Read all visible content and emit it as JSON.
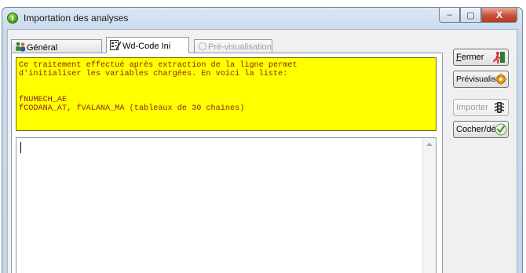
{
  "window": {
    "title": "Importation des analyses",
    "controls": {
      "minimize": "‒",
      "maximize": "▢",
      "close": "X"
    }
  },
  "tabs": [
    {
      "label": "Général",
      "icon": "people-icon",
      "state": "normal"
    },
    {
      "label": "Wd-Code Ini",
      "icon": "code-edit-icon",
      "state": "active"
    },
    {
      "label": "Pré-visualisation",
      "icon": "preview-icon",
      "state": "disabled"
    }
  ],
  "info_box": {
    "lines": [
      "Ce traitement effectué après extraction de la ligne permet",
      "d'initialiser les variables chargées. En voici la liste:",
      "",
      "",
      "fNUMECH_AE",
      "fCODANA_AT, fVALANA_MA (tableaux de 30 chaines)"
    ],
    "background": "#ffff00",
    "text_color": "#8b2323"
  },
  "editor": {
    "value": ""
  },
  "buttons": {
    "close": {
      "label_first": "F",
      "label_rest": "ermer",
      "icon": "exit-running-man-icon"
    },
    "preview": {
      "label": "Prévisualiser",
      "icon": "gear-icon"
    },
    "import": {
      "label": "Importer",
      "icon": "traffic-light-icon",
      "state": "disabled"
    },
    "check_uncheck": {
      "label": "Cocher/déc.",
      "icon": "checkmark-icon"
    }
  }
}
